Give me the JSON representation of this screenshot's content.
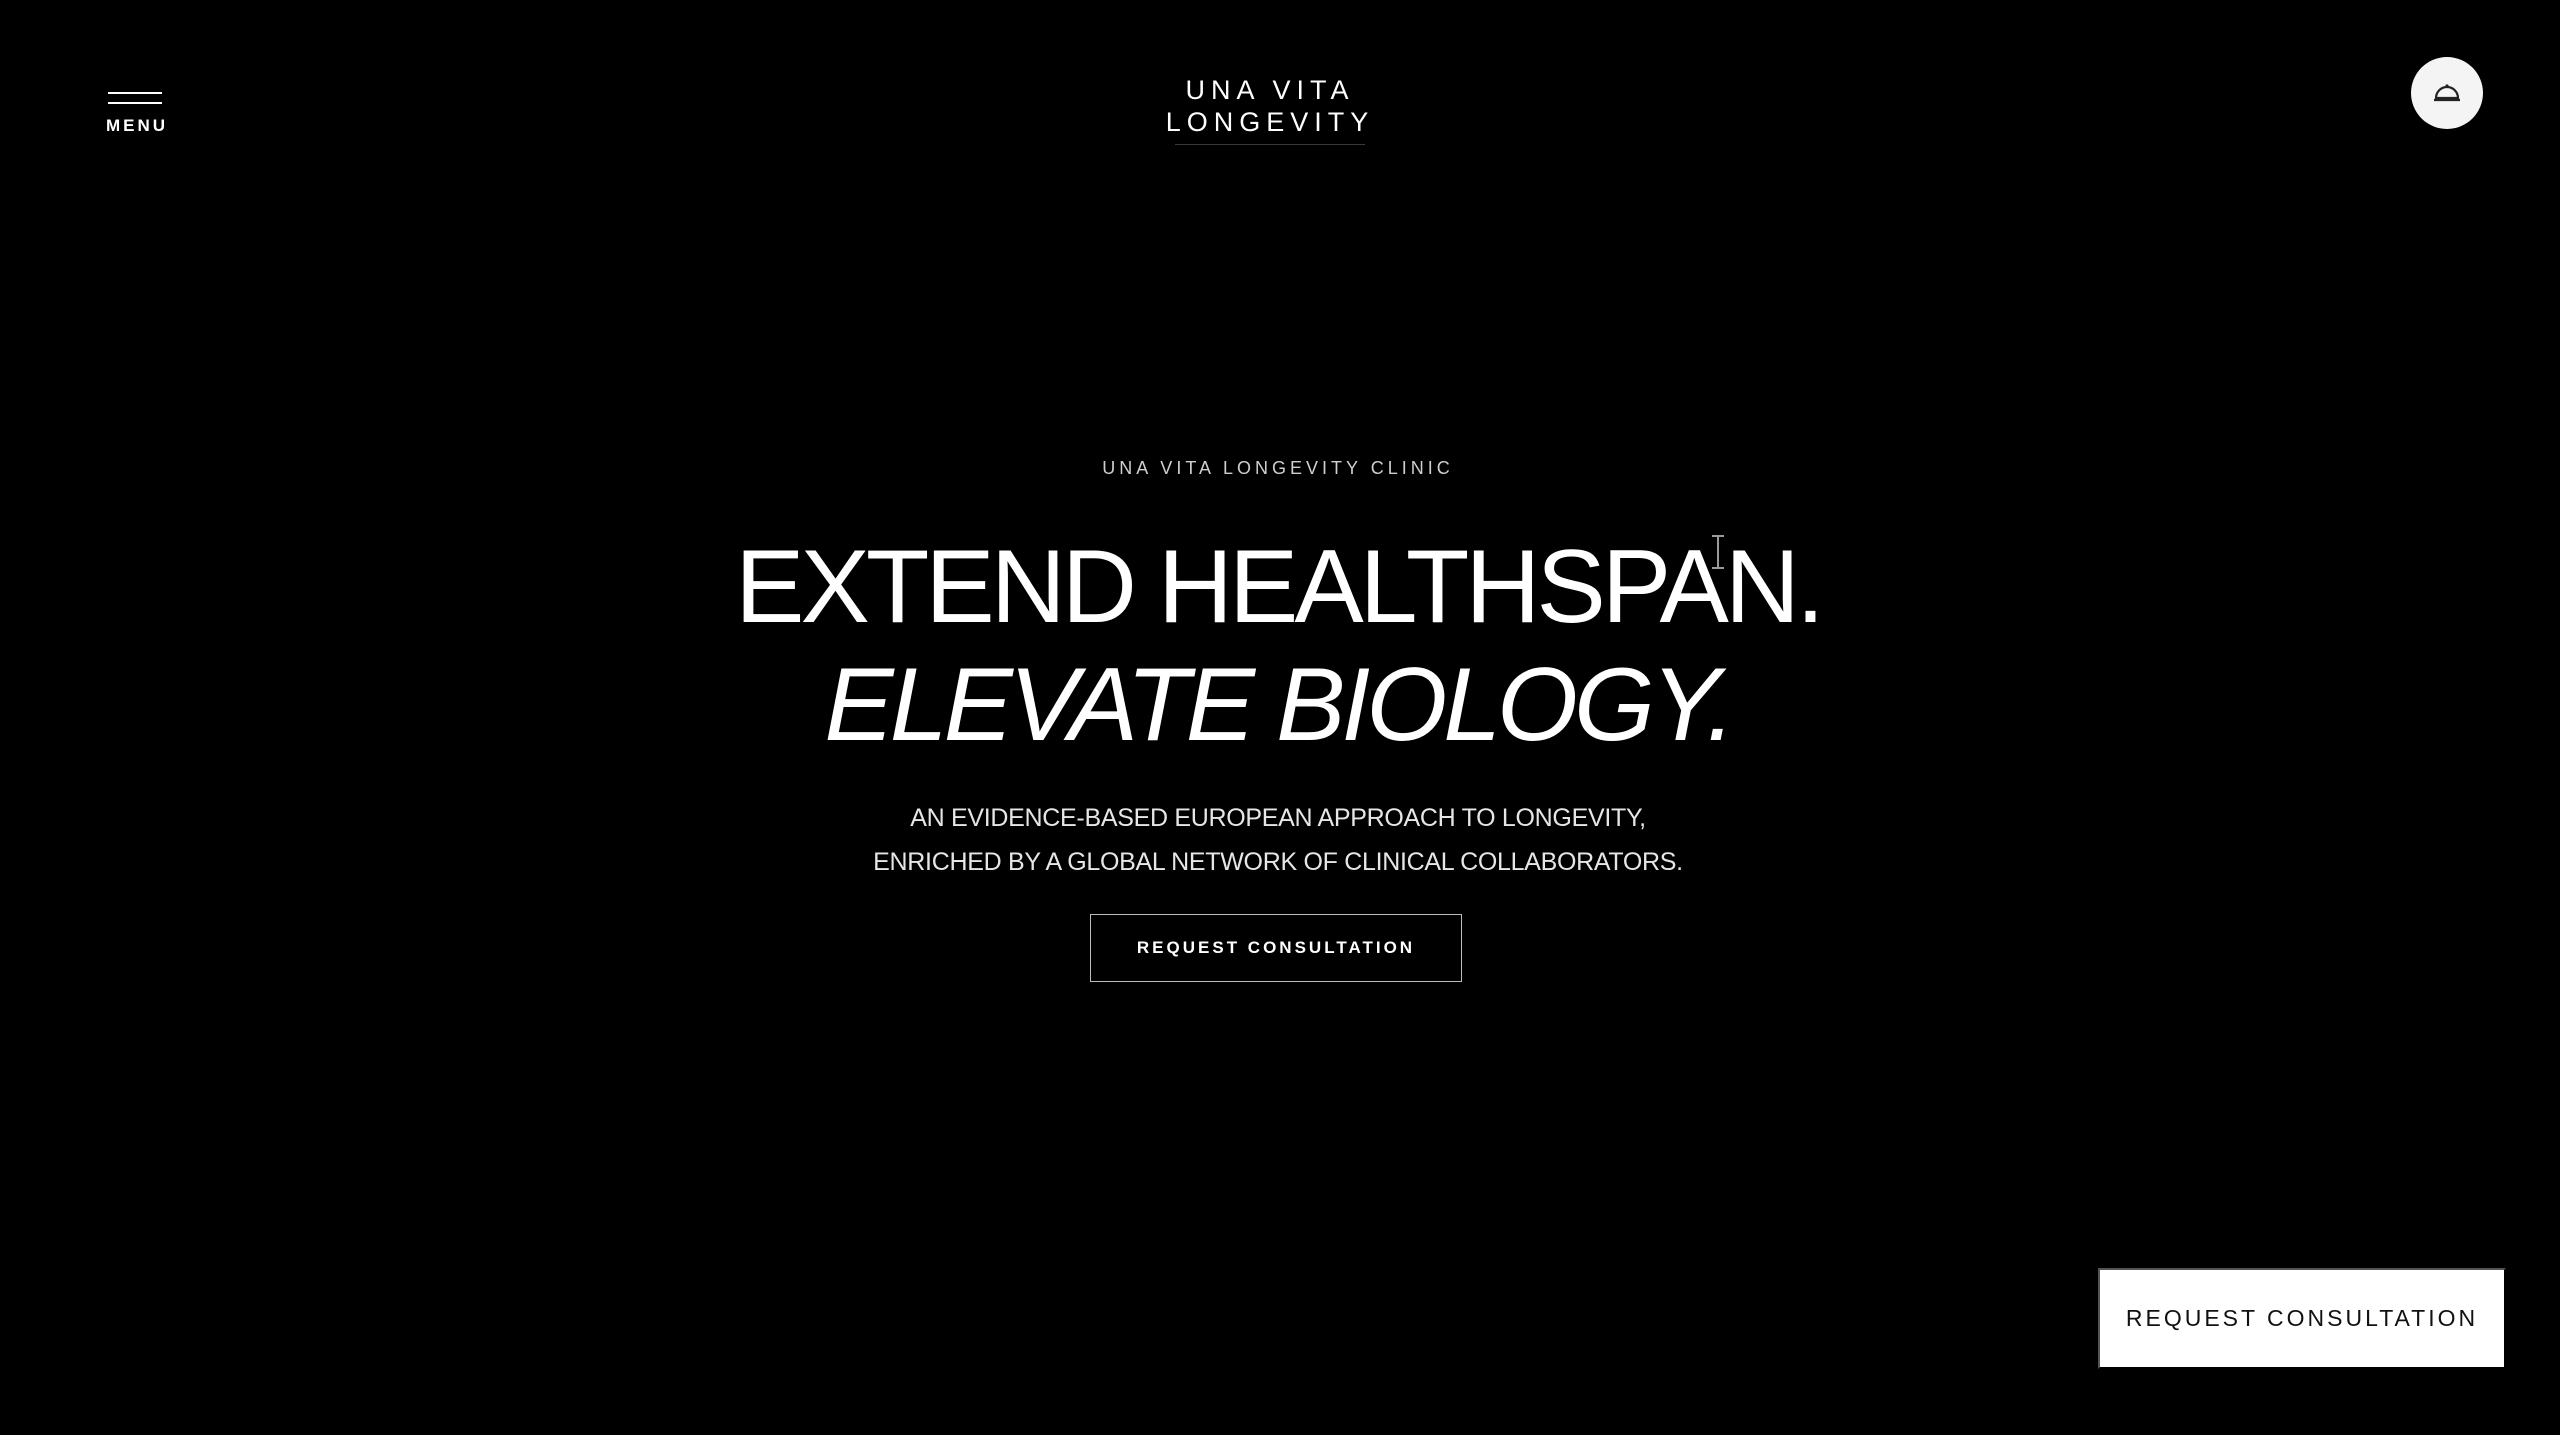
{
  "header": {
    "menu_label": "MENU",
    "logo_line1": "UNA VITA",
    "logo_line2": "LONGEVITY",
    "account_icon": "cloche-icon"
  },
  "hero": {
    "eyebrow": "UNA VITA LONGEVITY CLINIC",
    "headline_line1": "EXTEND HEALTHSPAN.",
    "headline_line2": "ELEVATE BIOLOGY.",
    "subtitle_line1": "AN EVIDENCE-BASED EUROPEAN APPROACH TO LONGEVITY,",
    "subtitle_line2": "ENRICHED BY A GLOBAL NETWORK OF CLINICAL COLLABORATORS.",
    "cta_label": "REQUEST CONSULTATION"
  },
  "floating_cta": {
    "label": "REQUEST CONSULTATION"
  },
  "colors": {
    "background": "#000000",
    "text": "#ffffff",
    "button_light": "#ffffff"
  }
}
